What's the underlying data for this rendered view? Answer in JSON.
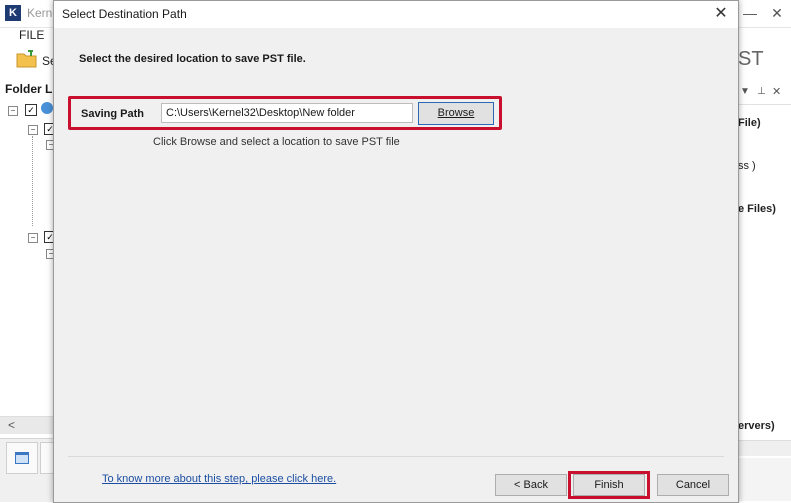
{
  "background_app": {
    "logo_letter": "K",
    "title": "Kerne",
    "menu_file": "FILE",
    "toolbar_text": "Se",
    "folder_list_header": "Folder Lis",
    "right_title": "ST",
    "right_lines": [
      "File)",
      "ss )",
      "e Files)",
      "ervers)"
    ],
    "window_controls": {
      "minimize": "—",
      "maximize": "☐",
      "close": "✕"
    },
    "icons": [
      "k-logo-icon",
      "folder-icon",
      "checkbox-icon",
      "expand-icon",
      "pin-icon",
      "calendar-icon"
    ]
  },
  "dialog": {
    "title": "Select Destination Path",
    "close_glyph": "✕",
    "instruction": "Select the desired location to save PST file.",
    "saving_path_label": "Saving Path",
    "saving_path_value": "C:\\Users\\Kernel32\\Desktop\\New folder",
    "browse_label": "Browse",
    "hint": "Click Browse and select a location to save PST file",
    "help_link": "To know more about this step, please click here.",
    "back_label": "< Back",
    "finish_label": "Finish",
    "cancel_label": "Cancel"
  },
  "colors": {
    "highlight_red": "#c8102e",
    "link_blue": "#1c4fa3",
    "dialog_bg": "#f0f0f0",
    "focus_blue": "#2a68b8"
  }
}
